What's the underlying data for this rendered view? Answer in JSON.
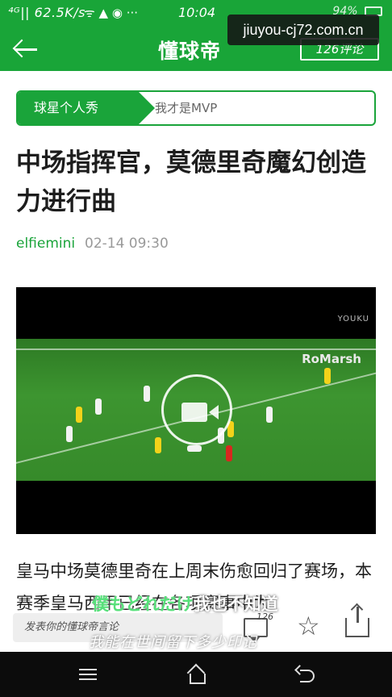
{
  "status_bar": {
    "network": "⁴ᴳ|| 62.5K/s",
    "time": "10:04",
    "battery": "94%"
  },
  "header": {
    "title": "懂球帝",
    "comments_label": "126评论"
  },
  "watermark": "jiuyou-cj72.com.cn",
  "category": {
    "tag": "球星个人秀",
    "subtag": "我才是MVP"
  },
  "article": {
    "title": "中场指挥官，莫德里奇魔幻创造力进行曲",
    "author": "elfiemini",
    "date": "02-14 09:30",
    "paragraph": "皇马中场莫德里奇在上周末伤愈回归了赛场，本赛季皇马西甲已经在各项赛事中为"
  },
  "video": {
    "source_watermark": "YOUKU",
    "channel_mark": "RoMarsh",
    "accent": "#2d7a24"
  },
  "lyrics": {
    "line1_green": "僕もどれだけ",
    "line1_white": "我也不知道",
    "line2": "我能在世间留下多少印记"
  },
  "bottom_bar": {
    "comment_placeholder": "发表你的懂球帝言论",
    "comment_count": "126"
  },
  "colors": {
    "brand_green": "#19a538",
    "author_green": "#1aa43a"
  }
}
